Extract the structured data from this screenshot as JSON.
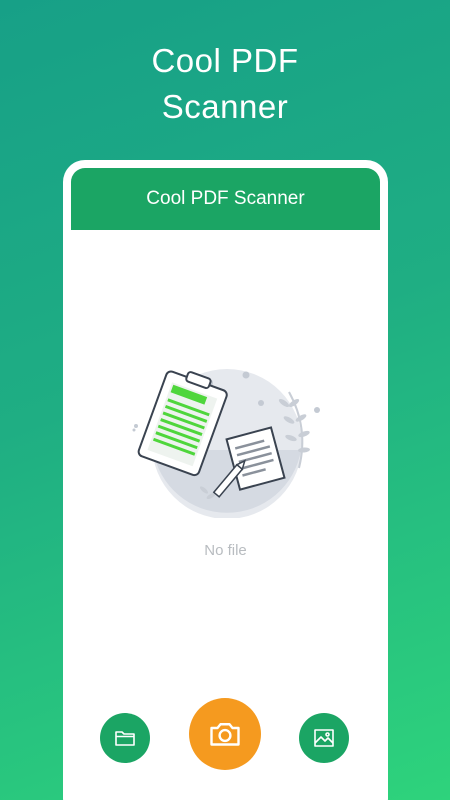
{
  "promo": {
    "title_line1": "Cool PDF",
    "title_line2": "Scanner"
  },
  "app": {
    "title": "Cool PDF Scanner"
  },
  "empty_state": {
    "text": "No file",
    "illustration": "clipboard-document-icon"
  },
  "actions": [
    {
      "icon": "folder-icon",
      "color": "#1ba564"
    },
    {
      "icon": "camera-icon",
      "color": "#f59a1f"
    },
    {
      "icon": "image-icon",
      "color": "#1ba564"
    }
  ],
  "colors": {
    "primary": "#1ba564",
    "accent": "#f59a1f",
    "background_start": "#17a087",
    "background_end": "#2ed37c"
  }
}
